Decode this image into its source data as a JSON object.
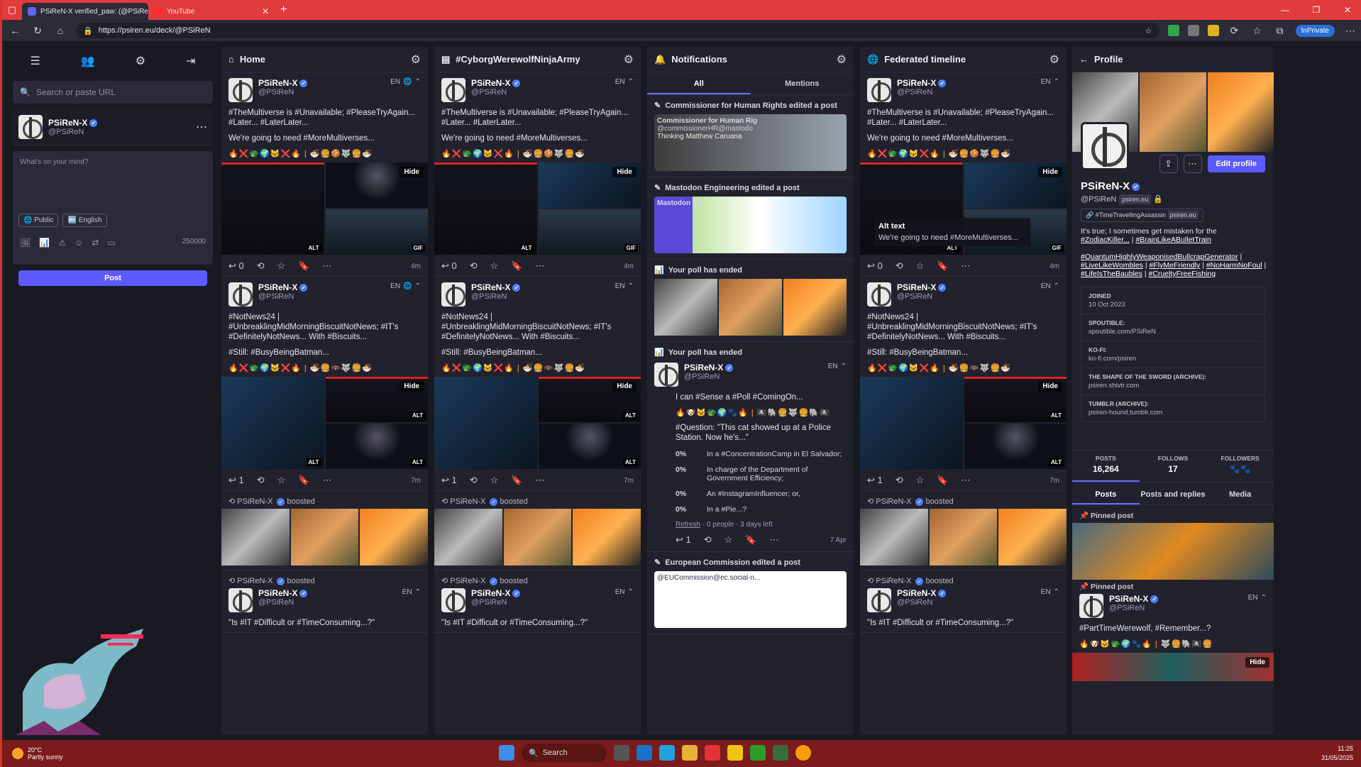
{
  "browser": {
    "tabs": [
      {
        "label": "PSiReN-X verified_paw: (@PSiReN",
        "active": true
      },
      {
        "label": "YouTube",
        "active": false
      }
    ],
    "url": "https://psiren.eu/deck/@PSiReN",
    "inprivate": "InPrivate"
  },
  "sidebar": {
    "search_placeholder": "Search or paste URL",
    "me": {
      "name": "PSiReN-X",
      "handle": "@PSiReN"
    },
    "compose_placeholder": "What's on your mind?",
    "visibility": "Public",
    "language": "English",
    "char_count": "250000",
    "post_label": "Post"
  },
  "columns": {
    "home": {
      "title": "Home"
    },
    "hashtag": {
      "title": "#CyborgWerewolfNinjaArmy"
    },
    "notifications": {
      "title": "Notifications",
      "tabs": [
        "All",
        "Mentions"
      ]
    },
    "federated": {
      "title": "Federated timeline"
    }
  },
  "post1": {
    "name": "PSiReN-X",
    "handle": "@PSiReN",
    "lang": "EN",
    "text1": "#TheMultiverse is #Unavailable; #PleaseTryAgain... #Later... #LaterLater...",
    "text2": "We're going to need #MoreMultiverses...",
    "emojis": "🔥❌🐲🌍🐱❌🔥 | 🍜🍔🍪🐺🍔🍜",
    "replies": "0",
    "time": "4m",
    "hide": "Hide",
    "alt": "ALT",
    "gif": "GIF"
  },
  "post2": {
    "name": "PSiReN-X",
    "handle": "@PSiReN",
    "lang": "EN",
    "text1": "#NotNews24 | #UnbreaklingMidMorningBiscuitNotNews; #IT's #DefinitelyNotNews... With #Biscuits...",
    "text2": "#Still: #BusyBeingBatman...",
    "emojis": "🔥❌🐲🌍🐱❌🔥 | 🍜🍔🦇🐺🍔🍜",
    "replies": "1",
    "time": "7m",
    "hide": "Hide",
    "alt": "ALT"
  },
  "boost": {
    "name": "PSiReN-X",
    "label": "boosted"
  },
  "post3": {
    "name": "PSiReN-X",
    "handle": "@PSiReN",
    "lang": "EN",
    "text": "\"Is #IT #Difficult or #TimeConsuming...?\""
  },
  "alt_overlay": {
    "title": "Alt text",
    "text": "We're going to need #MoreMultiverses..."
  },
  "notif": {
    "n1": "Commissioner for Human Rights edited a post",
    "n1_sub": "Commissioner for Human Rig",
    "n1_handle": "@commissionerHR@mastodo",
    "n1_name": "Thinking Matthew Caruana",
    "n2": "Mastodon Engineering edited a post",
    "n2_sub": "Mastodon En",
    "n3": "Your poll has ended",
    "n4": "Your poll has ended",
    "poll": {
      "name": "PSiReN-X",
      "handle": "@PSiReN",
      "lang": "EN",
      "text1": "I can #Sense a #Poll #ComingOn...",
      "emojis": "🔥🐶🐱🐲🌍🐾🔥 | 🏴‍☠️🐘🍔🐺🍔🐘🏴‍☠️",
      "question": "#Question: \"This cat showed up at a Police Station. Now he's...\"",
      "options": [
        {
          "pct": "0%",
          "text": "In a #ConcentrationCamp in El Salvador;"
        },
        {
          "pct": "0%",
          "text": "In charge of the Department of Government Efficiency;"
        },
        {
          "pct": "0%",
          "text": "An #InstagramInfluencer; or,"
        },
        {
          "pct": "0%",
          "text": "In a #Pie...?"
        }
      ],
      "refresh": "Refresh",
      "footer": "· 0 people · 3 days left",
      "replies": "1",
      "time": "7 Apr"
    },
    "n5": "European Commission edited a post",
    "n5_handle": "@EUCommission@ec.social-n..."
  },
  "profile": {
    "title": "Profile",
    "name": "PSiReN-X",
    "handle": "@PSiReN",
    "domain": "psiren.eu",
    "edit": "Edit profile",
    "field_k": "#TimeTravellingAssassin",
    "field_v": "psiren.eu",
    "bio1": "It's true; I sometimes get mistaken for the",
    "bio2": "#ZodiacKiller...",
    "bio3": "#BrainLikeABulletTrain",
    "bio4": "#QuantumHighlyWeaponisedBullcrapGenerator",
    "bio5": "#LiveLikeWombles",
    "bio6": "#FlyMeFriendly",
    "bio7": "#NoHarmNoFoul",
    "bio8": "#LifeIsTheBaubles",
    "bio9": "#CrueltyFreeFishing",
    "facts": [
      {
        "k": "JOINED",
        "v": "10 Oct 2023"
      },
      {
        "k": "SPOUTIBLE:",
        "v": "spoutible.com/PSiReN"
      },
      {
        "k": "KO-FI:",
        "v": "ko-fi.com/psiren"
      },
      {
        "k": "THE SHAPE OF THE SWORD (ARCHIVE):",
        "v": "psiren.shivtr.com"
      },
      {
        "k": "TUMBLR (ARCHIVE):",
        "v": "psiren-hound.tumblr.com"
      }
    ],
    "stats": [
      {
        "k": "POSTS",
        "v": "16,264"
      },
      {
        "k": "FOLLOWS",
        "v": "17"
      },
      {
        "k": "FOLLOWERS",
        "v": "🐾🐾"
      }
    ],
    "tabs": [
      "Posts",
      "Posts and replies",
      "Media"
    ],
    "pinned": "Pinned post",
    "pinned_text": "#PartTimeWerewolf, #Remember...?",
    "pinned_emojis": "🔥🐶🐱🐲🌍🐾🔥 | 🐺🍔🐘🏴‍☠️🍔",
    "hide": "Hide"
  },
  "taskbar": {
    "temp": "20°C",
    "weather": "Partly sunny",
    "search": "Search",
    "time": "11:25",
    "date": "31/05/2025"
  }
}
